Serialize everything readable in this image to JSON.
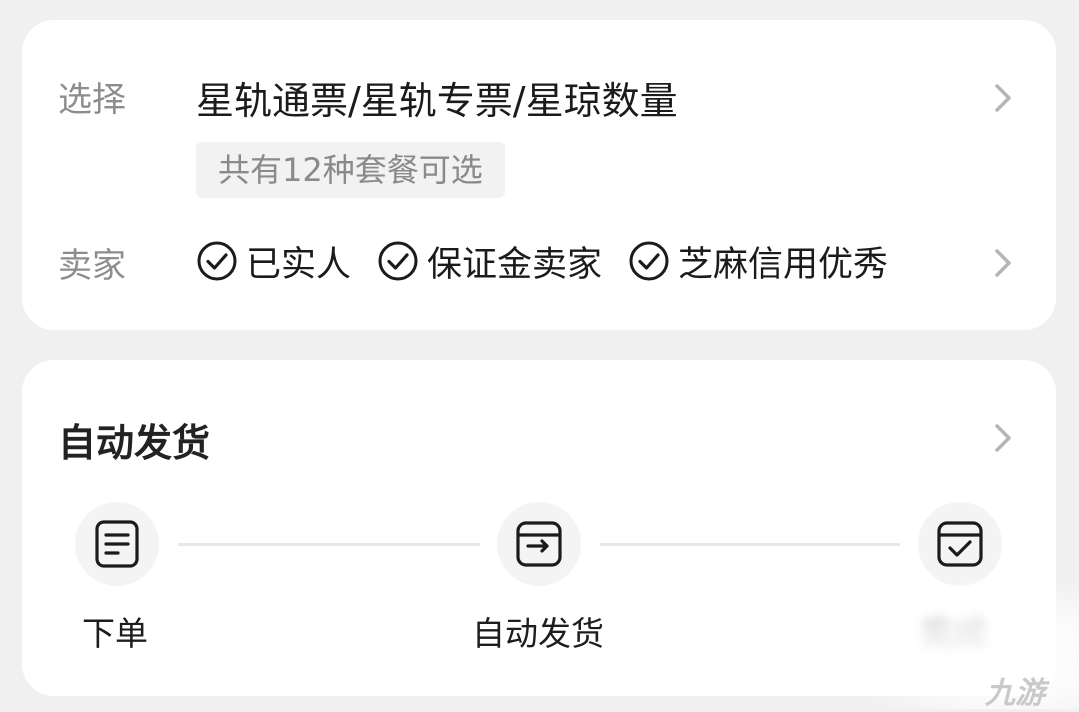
{
  "selection": {
    "label": "选择",
    "option": "星轨通票/星轨专票/星琼数量",
    "count_badge": "共有12种套餐可选"
  },
  "seller": {
    "label": "卖家",
    "tags": [
      "已实人",
      "保证金卖家",
      "芝麻信用优秀"
    ]
  },
  "delivery": {
    "title": "自动发货",
    "steps": [
      "下单",
      "自动发货",
      "完成"
    ]
  },
  "watermark": "九游",
  "icons": {
    "chevron": "chevron-right-icon",
    "check": "check-circle-icon",
    "order": "document-icon",
    "ship": "box-arrow-icon",
    "done": "box-check-icon"
  }
}
